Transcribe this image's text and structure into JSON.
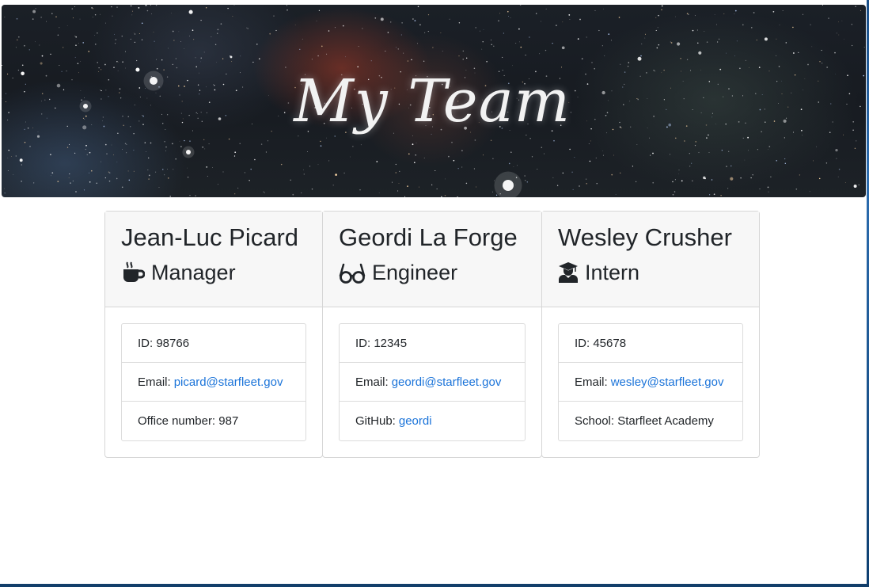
{
  "header": {
    "title": "My Team"
  },
  "colors": {
    "link": "#1a73d9",
    "card_header_bg": "#f7f7f7",
    "text": "#212529"
  },
  "team": [
    {
      "name": "Jean-Luc Picard",
      "role": "Manager",
      "role_icon": "coffee-mug-icon",
      "id_label": "ID: 98766",
      "email_prefix": "Email:",
      "email": "picard@starfleet.gov",
      "extra_label": "Office number: 987"
    },
    {
      "name": "Geordi La Forge",
      "role": "Engineer",
      "role_icon": "glasses-icon",
      "id_label": "ID: 12345",
      "email_prefix": "Email:",
      "email": "geordi@starfleet.gov",
      "extra_prefix": "GitHub:",
      "github": "geordi"
    },
    {
      "name": "Wesley Crusher",
      "role": "Intern",
      "role_icon": "graduate-icon",
      "id_label": "ID: 45678",
      "email_prefix": "Email:",
      "email": "wesley@starfleet.gov",
      "extra_label": "School: Starfleet Academy"
    }
  ]
}
